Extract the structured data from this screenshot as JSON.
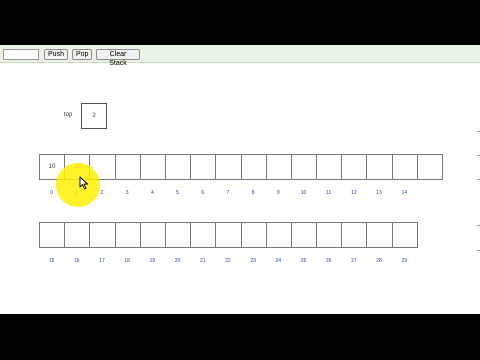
{
  "toolbar": {
    "input_value": "",
    "push_label": "Push",
    "pop_label": "Pop",
    "clear_label": "Clear Stack"
  },
  "top": {
    "label": "top",
    "value": "2"
  },
  "row1": {
    "cells": [
      "10",
      "20",
      "",
      "",
      "",
      "",
      "",
      "",
      "",
      "",
      "",
      "",
      "",
      "",
      "",
      ""
    ],
    "indices": [
      "0",
      "1",
      "2",
      "3",
      "4",
      "5",
      "6",
      "7",
      "8",
      "9",
      "10",
      "11",
      "12",
      "13",
      "14"
    ]
  },
  "row2": {
    "cells": [
      "",
      "",
      "",
      "",
      "",
      "",
      "",
      "",
      "",
      "",
      "",
      "",
      "",
      "",
      ""
    ],
    "indices": [
      "15",
      "16",
      "17",
      "18",
      "19",
      "20",
      "21",
      "22",
      "23",
      "24",
      "25",
      "26",
      "27",
      "28",
      "29"
    ]
  },
  "colors": {
    "toolbar_bg": "#eaf4e6",
    "index_text": "#2244aa",
    "cursor_highlight": "#fff000"
  },
  "icons": {
    "cursor": "arrow-cursor-icon"
  }
}
